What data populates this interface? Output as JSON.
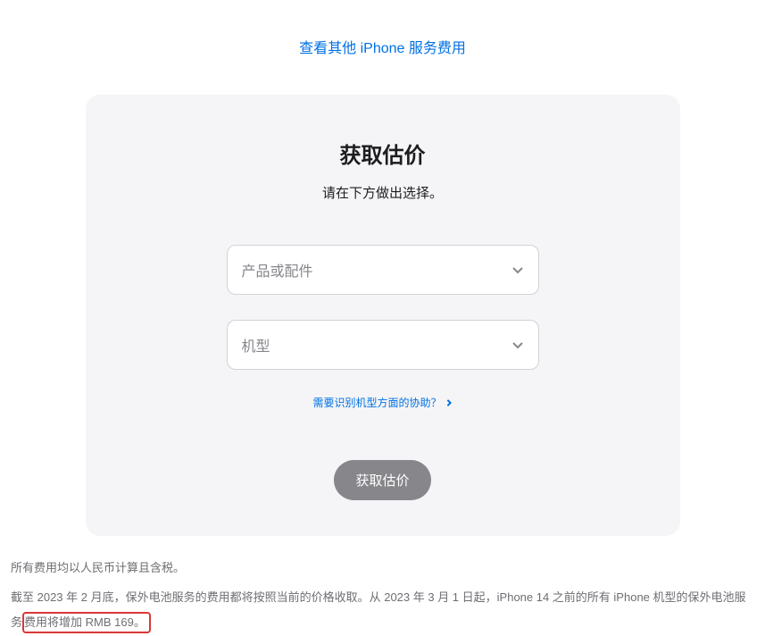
{
  "topLink": {
    "label": "查看其他 iPhone 服务费用"
  },
  "card": {
    "title": "获取估价",
    "subtitle": "请在下方做出选择。",
    "select1": {
      "placeholder": "产品或配件"
    },
    "select2": {
      "placeholder": "机型"
    },
    "helpLink": "需要识别机型方面的协助？",
    "submitLabel": "获取估价"
  },
  "footer": {
    "line1": "所有费用均以人民币计算且含税。",
    "line2_part1": "截至 2023 年 2 月底，保外电池服务的费用都将按照当前的价格收取。从 2023 年 3 月 1 日起，iPhone 14 之前的所有 iPhone 机型的保外电池服",
    "line2_part2": "务",
    "line2_highlight": "费用将增加 RMB 169。"
  }
}
